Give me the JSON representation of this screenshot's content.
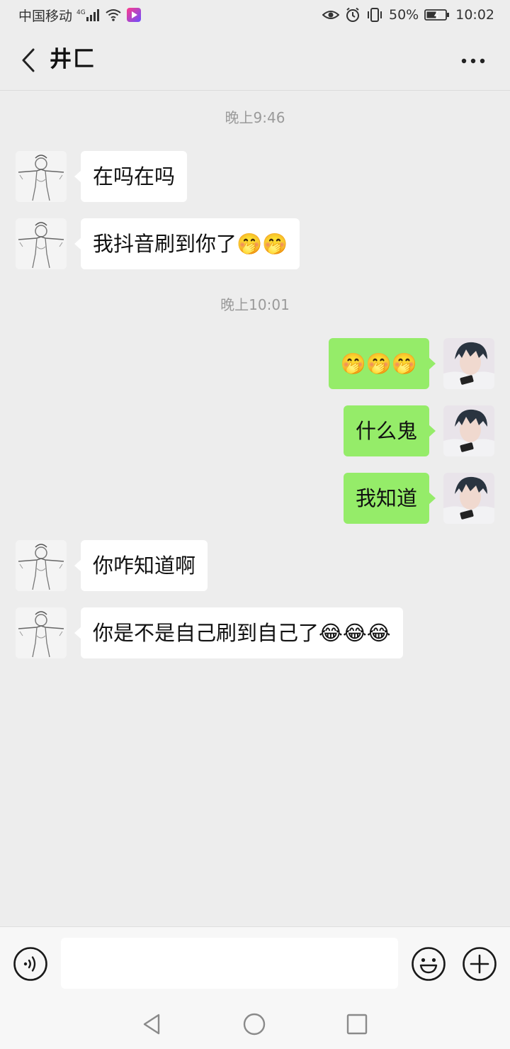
{
  "status_bar": {
    "carrier": "中国移动",
    "network": "4G",
    "battery_percent": "50%",
    "time": "10:02",
    "icons": [
      "signal-icon",
      "wifi-icon",
      "app-icon",
      "eye-icon",
      "alarm-icon",
      "vibrate-icon",
      "battery-icon"
    ]
  },
  "nav": {
    "title": "井匚",
    "back_icon": "chevron-left-icon",
    "more_icon": "more-dots-icon"
  },
  "chat": {
    "items": [
      {
        "kind": "timestamp",
        "text": "晚上9:46"
      },
      {
        "kind": "message",
        "side": "left",
        "text": "在吗在吗"
      },
      {
        "kind": "message",
        "side": "left",
        "text": "我抖音刷到你了🤭🤭"
      },
      {
        "kind": "timestamp",
        "text": "晚上10:01"
      },
      {
        "kind": "message",
        "side": "right",
        "text": "🤭🤭🤭"
      },
      {
        "kind": "message",
        "side": "right",
        "text": "什么鬼"
      },
      {
        "kind": "message",
        "side": "right",
        "text": "我知道"
      },
      {
        "kind": "message",
        "side": "left",
        "text": "你咋知道啊"
      },
      {
        "kind": "message",
        "side": "left",
        "text": "你是不是自己刷到自己了😂😂😂"
      }
    ]
  },
  "input_bar": {
    "value": "",
    "placeholder": "",
    "voice_icon": "voice-icon",
    "emoji_icon": "emoji-icon",
    "plus_icon": "plus-icon"
  },
  "system_nav": {
    "icons": [
      "back-triangle-icon",
      "home-circle-icon",
      "recents-square-icon"
    ]
  },
  "colors": {
    "background": "#ededed",
    "bubble_self": "#95ec69",
    "bubble_other": "#ffffff",
    "timestamp": "#9a9a9a"
  }
}
